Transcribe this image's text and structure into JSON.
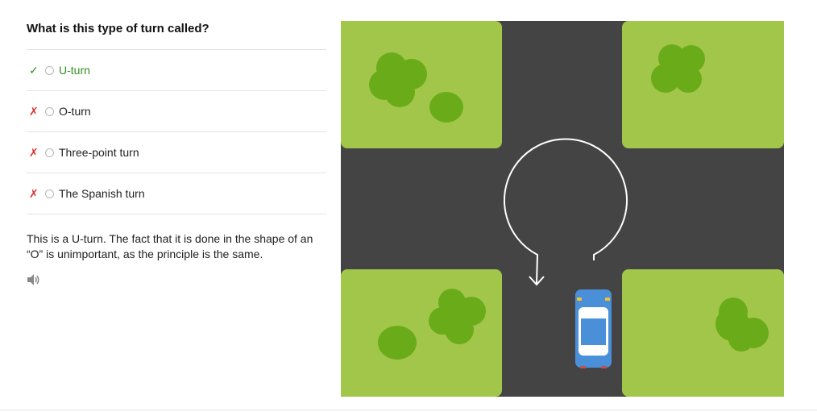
{
  "question": "What is this type of turn called?",
  "options": [
    {
      "mark": "✓",
      "status": "correct",
      "label": "U-turn"
    },
    {
      "mark": "✗",
      "status": "wrong",
      "label": "O-turn"
    },
    {
      "mark": "✗",
      "status": "wrong",
      "label": "Three-point turn"
    },
    {
      "mark": "✗",
      "status": "wrong",
      "label": "The Spanish turn"
    }
  ],
  "explanation": "This is a U-turn. The fact that it is done in the shape of an “O” is unimportant, as the principle is the same.",
  "audio_icon": "speaker-icon",
  "colors": {
    "correct": "#2f8f1f",
    "wrong": "#d9332f",
    "grass": "#a2c64a",
    "road": "#444444",
    "tree": "#6aab1a",
    "car": "#4a90d9"
  }
}
